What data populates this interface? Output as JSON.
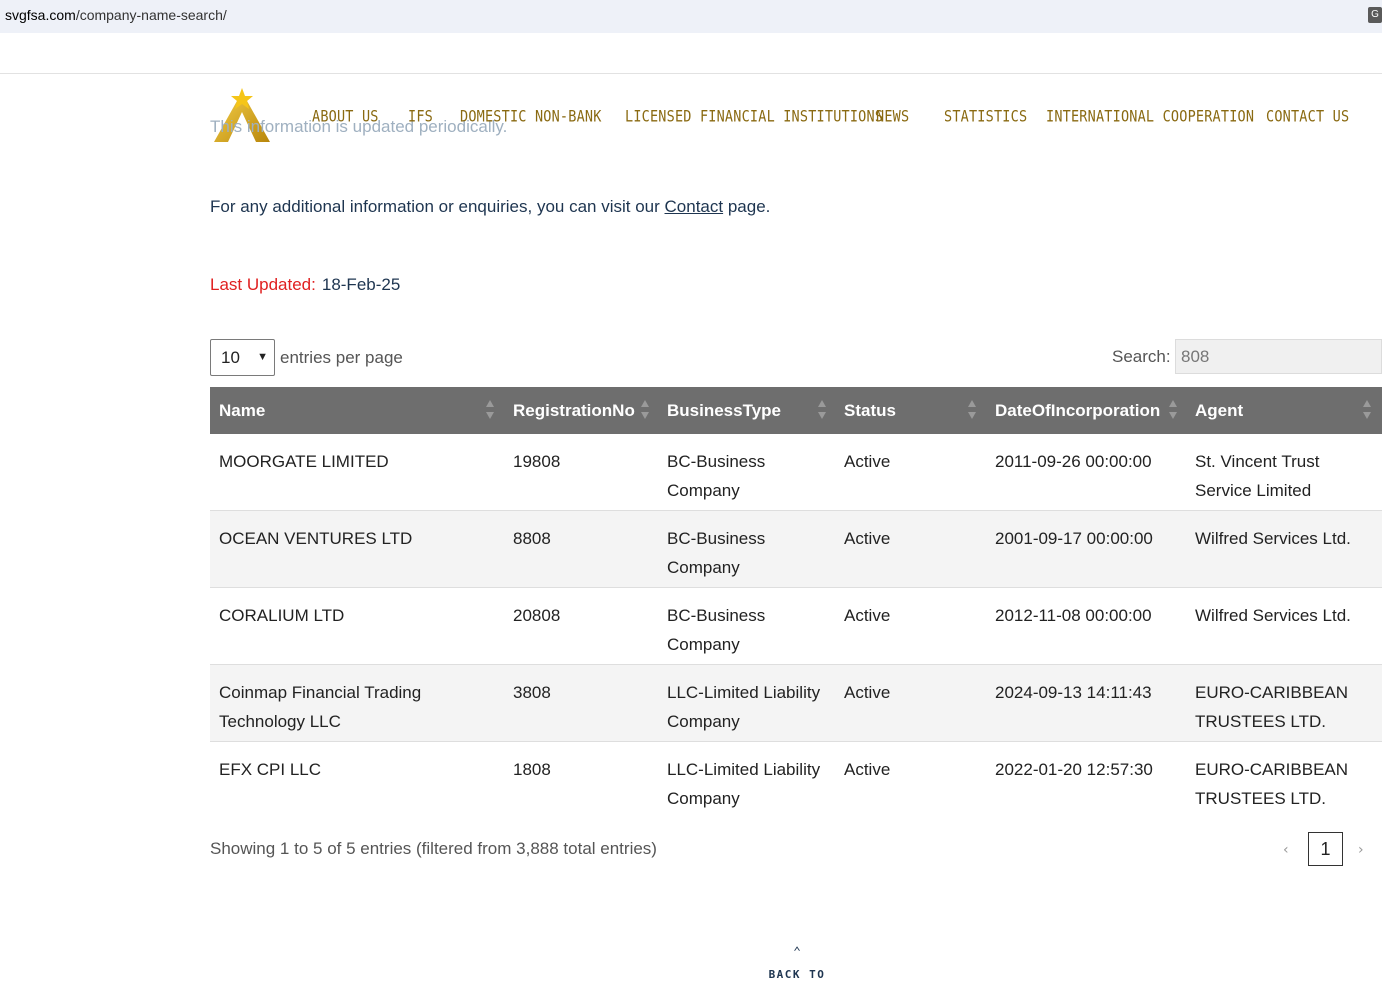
{
  "browser": {
    "url_host": "svgfsa.com",
    "url_path": "/company-name-search/",
    "translate_icon": "translate-icon"
  },
  "header": {
    "faded_text": "This information is updated periodically.",
    "nav": [
      "ABOUT US",
      "IFS",
      "DOMESTIC NON-BANK",
      "LICENSED FINANCIAL INSTITUTIONS",
      "NEWS",
      "STATISTICS",
      "INTERNATIONAL COOPERATION",
      "CONTACT US"
    ]
  },
  "info": {
    "before": "For any additional information or enquiries, you can visit our ",
    "link": "Contact",
    "after": " page."
  },
  "updated": {
    "label": "Last Updated:",
    "value": "18-Feb-25"
  },
  "controls": {
    "page_size": "10",
    "entries_label": "entries per page",
    "search_label": "Search:",
    "search_value": "808"
  },
  "table": {
    "headers": [
      "Name",
      "RegistrationNo",
      "BusinessType",
      "Status",
      "DateOfIncorporation",
      "Agent"
    ],
    "rows": [
      [
        "MOORGATE LIMITED",
        "19808",
        "BC-Business Company",
        "Active",
        "2011-09-26 00:00:00",
        "St. Vincent Trust Service Limited"
      ],
      [
        "OCEAN VENTURES LTD",
        "8808",
        "BC-Business Company",
        "Active",
        "2001-09-17 00:00:00",
        "Wilfred Services Ltd."
      ],
      [
        "CORALIUM LTD",
        "20808",
        "BC-Business Company",
        "Active",
        "2012-11-08 00:00:00",
        "Wilfred Services Ltd."
      ],
      [
        "Coinmap Financial Trading Technology LLC",
        "3808",
        "LLC-Limited Liability Company",
        "Active",
        "2024-09-13 14:11:43",
        "EURO-CARIBBEAN TRUSTEES LTD."
      ],
      [
        "EFX CPI LLC",
        "1808",
        "LLC-Limited Liability Company",
        "Active",
        "2022-01-20 12:57:30",
        "EURO-CARIBBEAN TRUSTEES LTD."
      ]
    ]
  },
  "footer": {
    "showing": "Showing 1 to 5 of 5 entries (filtered from 3,888 total entries)",
    "prev": "‹",
    "page": "1",
    "next": "›",
    "back_to_top": "BACK TO TOP"
  },
  "colors": {
    "nav_gold": "#8a6a12",
    "header_bg": "#6e6e6e",
    "label_red": "#e02020",
    "text_navy": "#1e3550"
  }
}
